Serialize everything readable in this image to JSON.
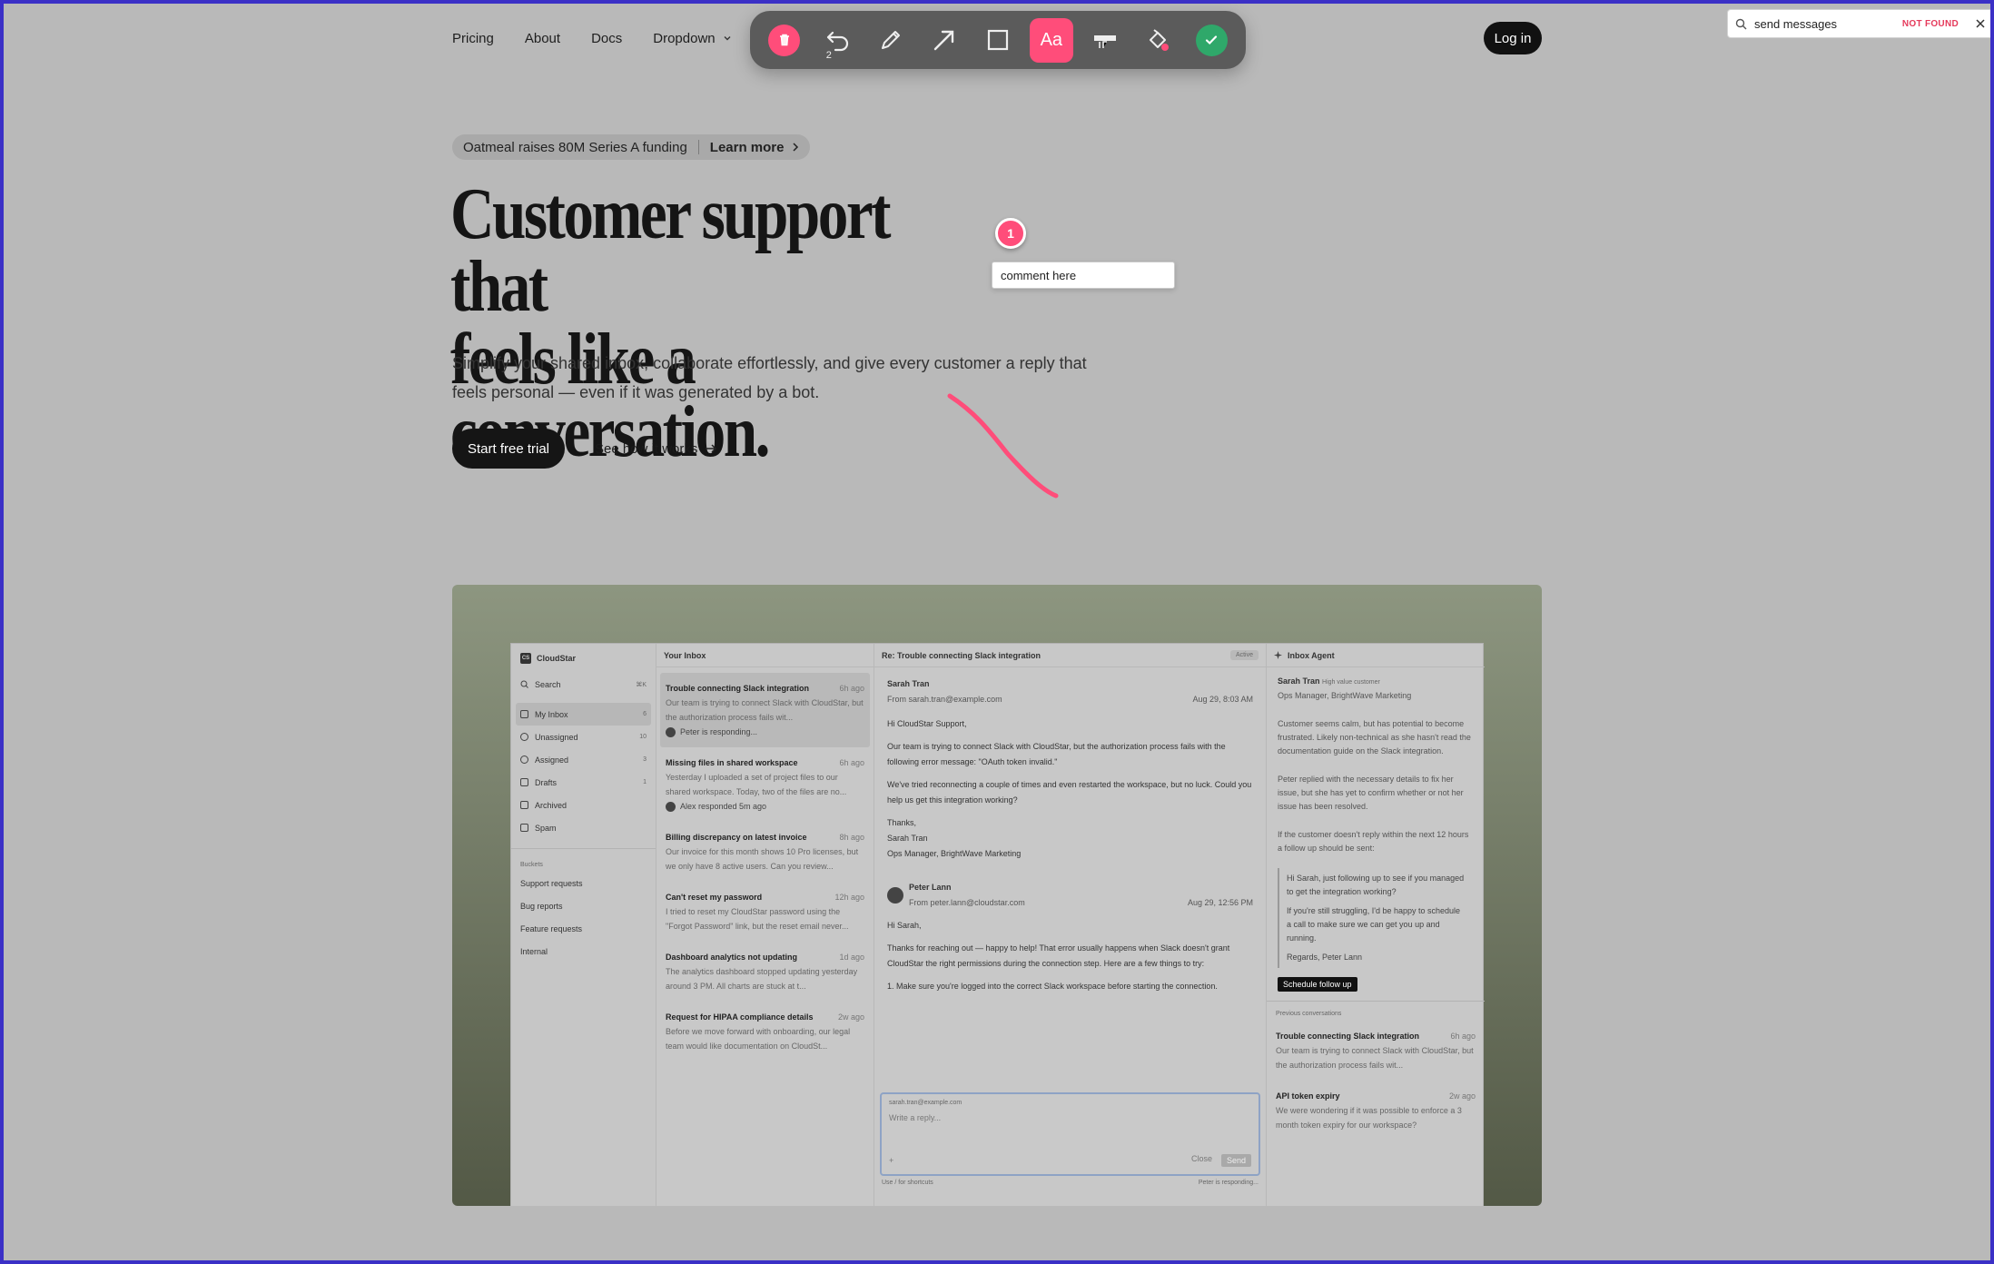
{
  "nav": {
    "items": [
      "Pricing",
      "About",
      "Docs",
      "Dropdown"
    ],
    "login": "Log in"
  },
  "toolbar": {
    "undo_count": "2",
    "text_tool": "Aa"
  },
  "find": {
    "query": "send messages",
    "status": "NOT FOUND"
  },
  "announcement": {
    "text": "Oatmeal raises 80M Series A funding",
    "link": "Learn more"
  },
  "hero": {
    "line1": "Customer support that",
    "line2": "feels like a conversation.",
    "subtitle_line1": "Simplify your shared inbox, collaborate effortlessly, and give every customer a reply that",
    "subtitle_line2": "feels personal — even if it was generated by a bot.",
    "cta_primary": "Start free trial",
    "cta_secondary": "See how it works"
  },
  "annotation": {
    "number": "1",
    "comment": "comment here"
  },
  "colors": {
    "accent": "#ff4d7a",
    "confirm": "#2fa86a",
    "toolbar": "#5b5b5b"
  },
  "app": {
    "workspace": "CloudStar",
    "search": "Search",
    "search_shortcut": "⌘K",
    "mailboxes": [
      {
        "label": "My Inbox",
        "count": "6"
      },
      {
        "label": "Unassigned",
        "count": "10"
      },
      {
        "label": "Assigned",
        "count": "3"
      },
      {
        "label": "Drafts",
        "count": "1"
      },
      {
        "label": "Archived",
        "count": ""
      },
      {
        "label": "Spam",
        "count": ""
      }
    ],
    "buckets_label": "Buckets",
    "buckets": [
      "Support requests",
      "Bug reports",
      "Feature requests",
      "Internal"
    ],
    "inbox_title": "Your Inbox",
    "conversations": [
      {
        "title": "Trouble connecting Slack integration",
        "time": "6h ago",
        "preview": "Our team is trying to connect Slack with CloudStar, but the authorization process fails wit...",
        "status": "Peter is responding..."
      },
      {
        "title": "Missing files in shared workspace",
        "time": "6h ago",
        "preview": "Yesterday I uploaded a set of project files to our shared workspace. Today, two of the files are no...",
        "status": "Alex responded 5m ago"
      },
      {
        "title": "Billing discrepancy on latest invoice",
        "time": "8h ago",
        "preview": "Our invoice for this month shows 10 Pro licenses, but we only have 8 active users. Can you review...",
        "status": ""
      },
      {
        "title": "Can't reset my password",
        "time": "12h ago",
        "preview": "I tried to reset my CloudStar password using the \"Forgot Password\" link, but the reset email never...",
        "status": ""
      },
      {
        "title": "Dashboard analytics not updating",
        "time": "1d ago",
        "preview": "The analytics dashboard stopped updating yesterday around 3 PM. All charts are stuck at t...",
        "status": ""
      },
      {
        "title": "Request for HIPAA compliance details",
        "time": "2w ago",
        "preview": "Before we move forward with onboarding, our legal team would like documentation on CloudSt...",
        "status": ""
      }
    ],
    "thread": {
      "title": "Re: Trouble connecting Slack integration",
      "status": "Active",
      "msg1": {
        "name": "Sarah Tran",
        "from": "From  sarah.tran@example.com",
        "date": "Aug 29, 8:03 AM",
        "l1": "Hi CloudStar Support,",
        "l2": "Our team is trying to connect Slack with CloudStar, but the authorization process fails with the following error message: \"OAuth token invalid.\"",
        "l3": "We've tried reconnecting a couple of times and even restarted the workspace, but no luck. Could you help us get this integration working?",
        "l4": "Thanks,",
        "l5": "Sarah Tran",
        "l6": "Ops Manager, BrightWave Marketing"
      },
      "msg2": {
        "name": "Peter Lann",
        "from": "From  peter.lann@cloudstar.com",
        "date": "Aug 29, 12:56 PM",
        "l1": "Hi Sarah,",
        "l2": "Thanks for reaching out — happy to help! That error usually happens when Slack doesn't grant CloudStar the right permissions during the connection step. Here are a few things to try:",
        "l3": "1. Make sure you're logged into the correct Slack workspace before starting the connection."
      },
      "reply_to": "sarah.tran@example.com",
      "reply_placeholder": "Write a reply...",
      "close": "Close",
      "send": "Send",
      "hint": "Use / for shortcuts",
      "responding": "Peter is responding..."
    },
    "agent": {
      "title": "Inbox Agent",
      "name": "Sarah Tran",
      "tag": "High value customer",
      "role": "Ops Manager, BrightWave Marketing",
      "p1": "Customer seems calm, but has potential to become frustrated. Likely non-technical as she hasn't read the documentation guide on the Slack integration.",
      "p2": "Peter replied with the necessary details to fix her issue, but she has yet to confirm whether or not her issue has been resolved.",
      "p3": "If the customer doesn't reply within the next 12 hours a follow up should be sent:",
      "q1": "Hi Sarah, just following up to see if you managed to get the integration working?",
      "q2": "If you're still struggling, I'd be happy to schedule a call to make sure we can get you up and running.",
      "q3": "Regards, Peter Lann",
      "button": "Schedule follow up",
      "prev_label": "Previous conversations",
      "prev": [
        {
          "title": "Trouble connecting Slack integration",
          "time": "6h ago",
          "preview": "Our team is trying to connect Slack with CloudStar, but the authorization process fails wit..."
        },
        {
          "title": "API token expiry",
          "time": "2w ago",
          "preview": "We were wondering if it was possible to enforce a 3 month token expiry for our workspace?"
        }
      ]
    }
  }
}
